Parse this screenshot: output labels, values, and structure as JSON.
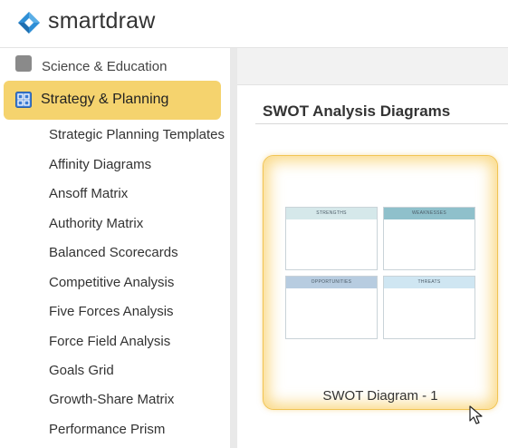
{
  "header": {
    "brand_name": "smartdraw",
    "logo_icon": "smartdraw-logo-icon",
    "brand_color": "#2f8fd6"
  },
  "sidebar": {
    "previous_category": {
      "label": "Science & Education",
      "icon": "science-icon"
    },
    "active_category": {
      "label": "Strategy & Planning",
      "icon": "strategy-icon"
    },
    "items": [
      {
        "label": "Strategic Planning Templates"
      },
      {
        "label": "Affinity Diagrams"
      },
      {
        "label": "Ansoff Matrix"
      },
      {
        "label": "Authority Matrix"
      },
      {
        "label": "Balanced Scorecards"
      },
      {
        "label": "Competitive Analysis"
      },
      {
        "label": "Five Forces Analysis"
      },
      {
        "label": "Force Field Analysis"
      },
      {
        "label": "Goals Grid"
      },
      {
        "label": "Growth-Share Matrix"
      },
      {
        "label": "Performance Prism"
      }
    ],
    "active_color": "#f5d36e"
  },
  "main": {
    "section_title": "SWOT Analysis Diagrams",
    "templates": [
      {
        "caption": "SWOT Diagram - 1",
        "quadrants": [
          {
            "label": "STRENGTHS",
            "color": "#d5e8ea"
          },
          {
            "label": "WEAKNESSES",
            "color": "#8fc0cb"
          },
          {
            "label": "OPPORTUNITIES",
            "color": "#b7cce0"
          },
          {
            "label": "THREATS",
            "color": "#cfe6f2"
          }
        ]
      }
    ]
  }
}
